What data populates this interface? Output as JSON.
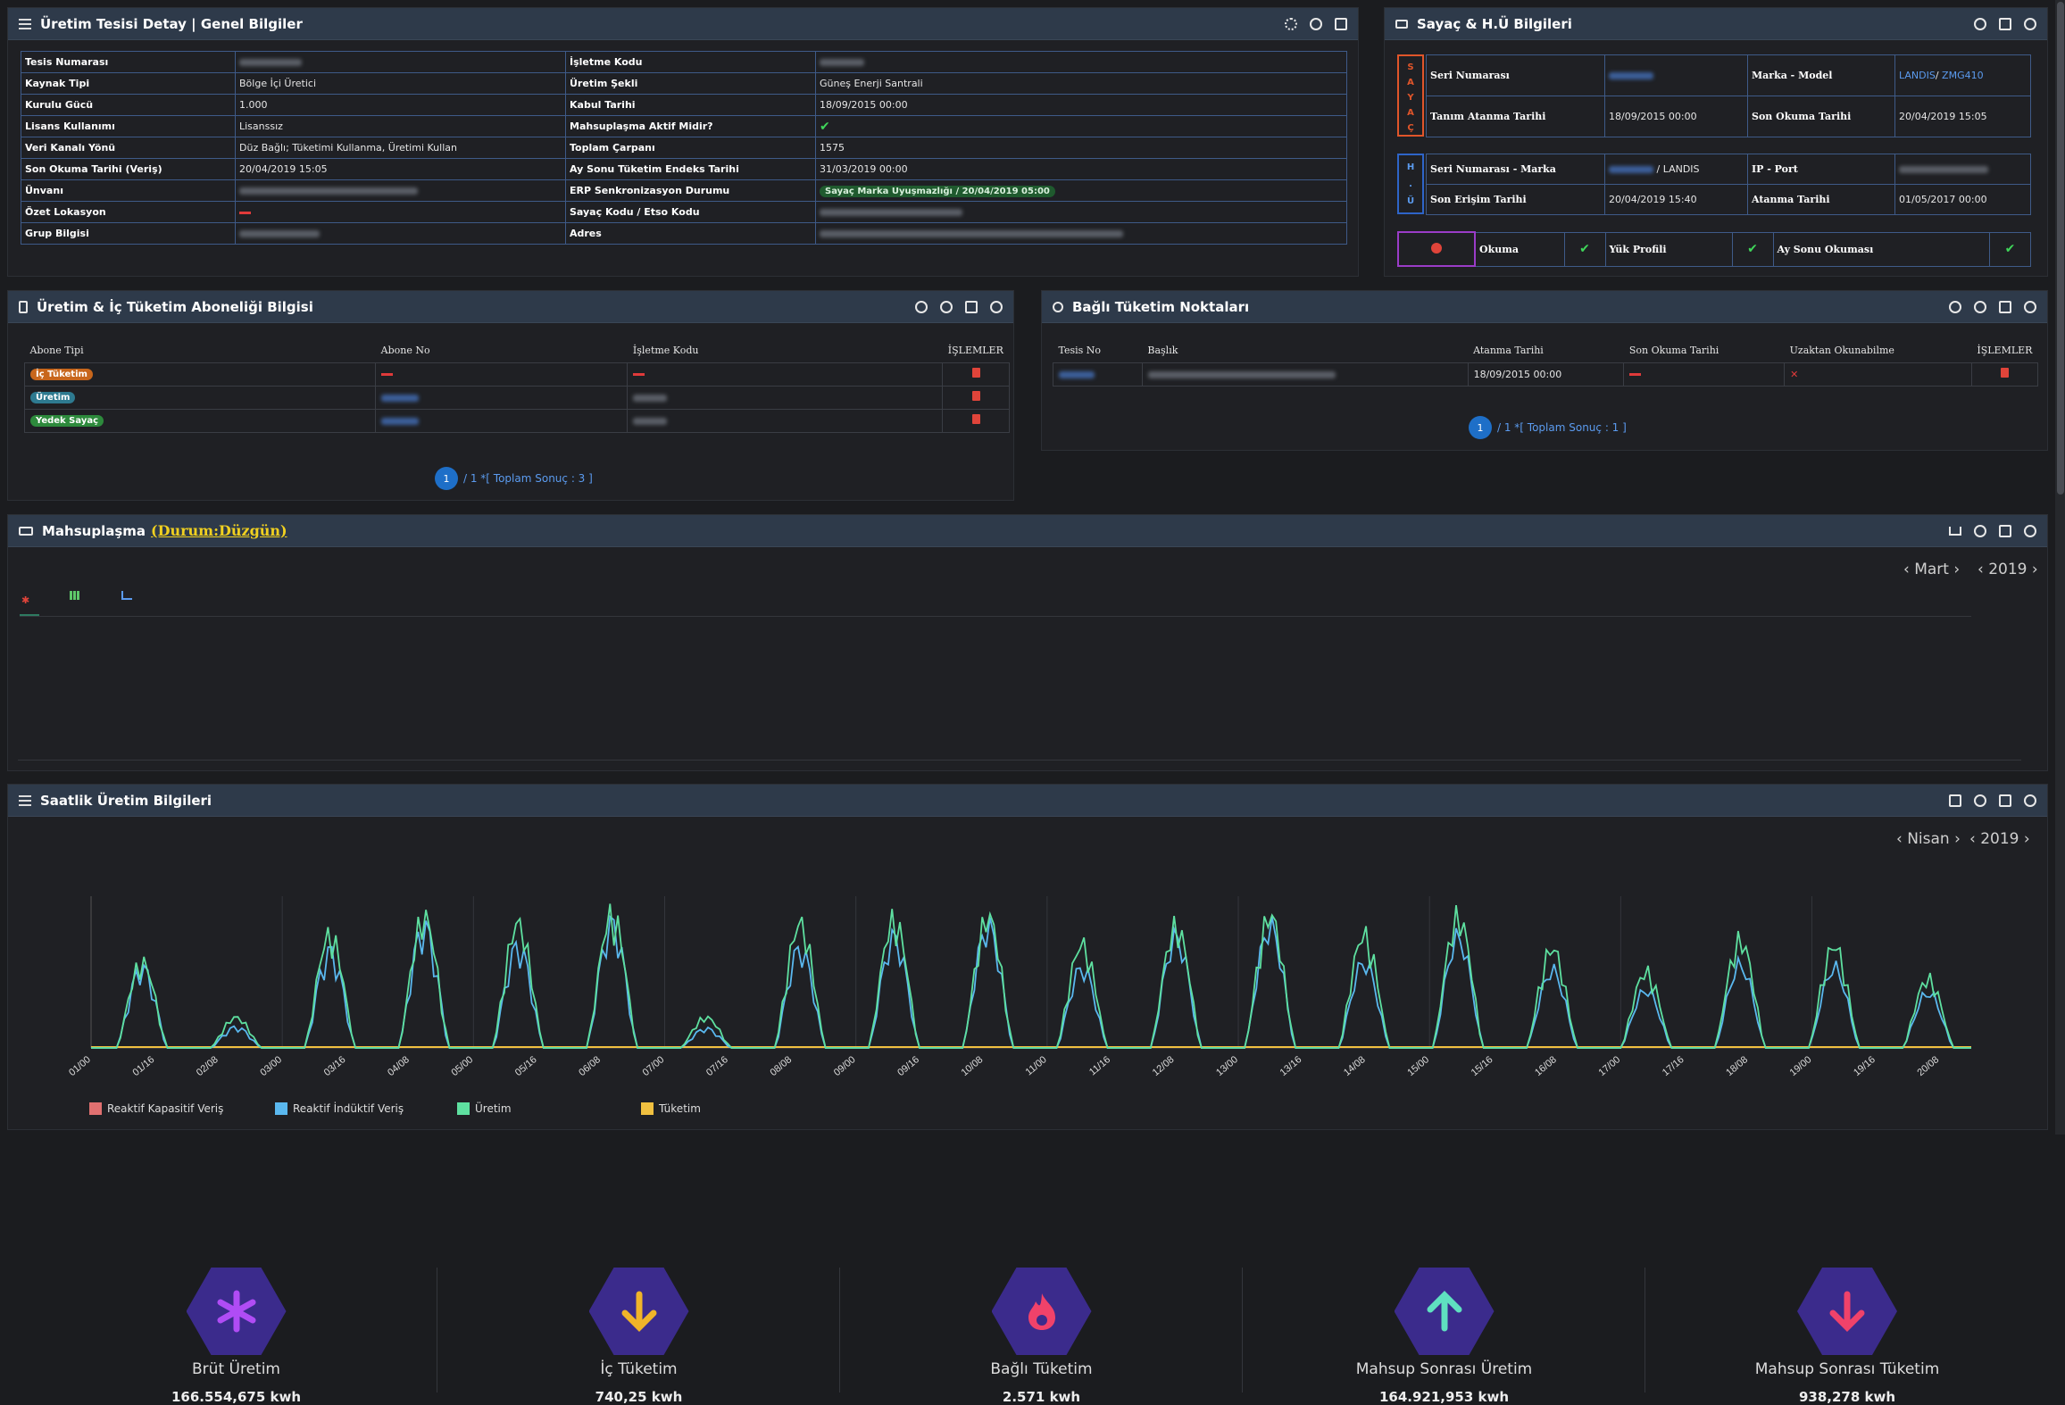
{
  "general": {
    "title": "Üretim Tesisi Detay | Genel Bilgiler",
    "rows": [
      {
        "k1": "Tesis Numarası",
        "v1": "",
        "k2": "İşletme Kodu",
        "v2": ""
      },
      {
        "k1": "Kaynak Tipi",
        "v1": "Bölge İçi Üretici",
        "k2": "Üretim Şekli",
        "v2": "Güneş Enerji Santrali"
      },
      {
        "k1": "Kurulu Gücü",
        "v1": "1.000",
        "k2": "Kabul Tarihi",
        "v2": "18/09/2015 00:00"
      },
      {
        "k1": "Lisans Kullanımı",
        "v1": "Lisanssız",
        "k2": "Mahsuplaşma Aktif Midir?",
        "v2": "✔"
      },
      {
        "k1": "Veri Kanalı Yönü",
        "v1": "Düz Bağlı; Tüketimi Kullanma, Üretimi Kullan",
        "k2": "Toplam Çarpanı",
        "v2": "1575"
      },
      {
        "k1": "Son Okuma Tarihi (Veriş)",
        "v1": "20/04/2019 15:05",
        "k2": "Ay Sonu Tüketim Endeks Tarihi",
        "v2": "31/03/2019 00:00"
      },
      {
        "k1": "Ünvanı",
        "v1": "",
        "k2": "ERP Senkronizasyon Durumu",
        "v2": "Sayaç Marka Uyuşmazlığı / 20/04/2019 05:00"
      },
      {
        "k1": "Özet Lokasyon",
        "v1": "",
        "k2": "Sayaç Kodu / Etso Kodu",
        "v2": ""
      },
      {
        "k1": "Grup Bilgisi",
        "v1": "",
        "k2": "Adres",
        "v2": ""
      }
    ]
  },
  "meter": {
    "title": "Sayaç & H.Ü Bilgileri",
    "sayac_letters": [
      "S",
      "A",
      "Y",
      "A",
      "Ç"
    ],
    "hu_letters": [
      "H",
      ".",
      "Ü"
    ],
    "seri_label": "Seri Numarası",
    "marka_label": "Marka - Model",
    "marka_value": "LANDIS",
    "model_value": "ZMG410",
    "tanim_label": "Tanım Atanma Tarihi",
    "tanim_value": "18/09/2015 00:00",
    "son_okuma_label": "Son Okuma Tarihi",
    "son_okuma_value": "20/04/2019 15:05",
    "hu_seri_label": "Seri Numarası - Marka",
    "hu_marka": "LANDIS",
    "ip_label": "IP - Port",
    "erisim_label": "Son Erişim Tarihi",
    "erisim_value": "20/04/2019 15:40",
    "atanma_label": "Atanma Tarihi",
    "atanma_value": "01/05/2017 00:00",
    "okuma_label": "Okuma",
    "yuk_label": "Yük Profili",
    "ay_sonu_label": "Ay Sonu Okuması"
  },
  "subscription": {
    "title": "Üretim & İç Tüketim Aboneliği Bilgisi",
    "headers": [
      "Abone Tipi",
      "Abone No",
      "İşletme Kodu",
      "İŞLEMLER"
    ],
    "rows": [
      {
        "type": "İç Tüketim",
        "color": "#c8661c"
      },
      {
        "type": "Üretim",
        "color": "#2e7a90"
      },
      {
        "type": "Yedek Sayaç",
        "color": "#2d8a3c"
      }
    ],
    "page": "1",
    "total": "/ 1 *[ Toplam Sonuç : 3 ]"
  },
  "connected": {
    "title": "Bağlı Tüketim Noktaları",
    "headers": [
      "Tesis No",
      "Başlık",
      "Atanma Tarihi",
      "Son Okuma Tarihi",
      "Uzaktan Okunabilme",
      "İŞLEMLER"
    ],
    "row": {
      "atanma": "18/09/2015 00:00"
    },
    "page": "1",
    "total": "/ 1 *[ Toplam Sonuç : 1 ]"
  },
  "netting": {
    "title": "Mahsuplaşma",
    "status": "(Durum:Düzgün)",
    "month": "Mart",
    "year": "2019",
    "stats": [
      {
        "label": "Brüt Üretim",
        "value": "166.554,675",
        "unit": "kwh",
        "icon": "asterisk-icon",
        "color": "#b04cf5"
      },
      {
        "label": "İç Tüketim",
        "value": "740,25",
        "unit": "kwh",
        "icon": "arrow-down-icon",
        "color": "#f0b429"
      },
      {
        "label": "Bağlı Tüketim",
        "value": "2.571",
        "unit": "kwh",
        "icon": "fire-icon",
        "color": "#f0426a"
      },
      {
        "label": "Mahsup Sonrası Üretim",
        "value": "164.921,953",
        "unit": "kwh",
        "icon": "arrow-up-icon",
        "color": "#5fe0c0"
      },
      {
        "label": "Mahsup Sonrası Tüketim",
        "value": "938,278",
        "unit": "kwh",
        "icon": "arrow-down-icon",
        "color": "#f0426a"
      }
    ]
  },
  "hourly": {
    "title": "Saatlik Üretim Bilgileri",
    "month": "Nisan",
    "year": "2019"
  },
  "chart_data": {
    "type": "line",
    "x_ticks": [
      "01/00",
      "01/16",
      "02/08",
      "03/00",
      "03/16",
      "04/08",
      "05/00",
      "05/16",
      "06/08",
      "07/00",
      "07/16",
      "08/08",
      "09/00",
      "09/16",
      "10/08",
      "11/00",
      "11/16",
      "12/08",
      "13/00",
      "13/16",
      "14/08",
      "15/00",
      "15/16",
      "16/08",
      "17/00",
      "17/16",
      "18/08",
      "19/00",
      "19/16",
      "20/08"
    ],
    "series": [
      {
        "name": "Reaktif Kapasitif Veriş",
        "color": "#e07070"
      },
      {
        "name": "Reaktif İndüktif Veriş",
        "color": "#5ab8ef"
      },
      {
        "name": "Üretim",
        "color": "#5ee0a0"
      },
      {
        "name": "Tüketim",
        "color": "#f0c040"
      }
    ],
    "days": [
      {
        "u": 0.62,
        "r": 0.58
      },
      {
        "u": 0.22,
        "r": 0.15
      },
      {
        "u": 0.82,
        "r": 0.7
      },
      {
        "u": 0.95,
        "r": 0.88
      },
      {
        "u": 0.9,
        "r": 0.74
      },
      {
        "u": 0.97,
        "r": 0.9
      },
      {
        "u": 0.22,
        "r": 0.14
      },
      {
        "u": 0.9,
        "r": 0.72
      },
      {
        "u": 0.93,
        "r": 0.8
      },
      {
        "u": 0.95,
        "r": 0.88
      },
      {
        "u": 0.75,
        "r": 0.58
      },
      {
        "u": 0.88,
        "r": 0.8
      },
      {
        "u": 0.96,
        "r": 0.88
      },
      {
        "u": 0.82,
        "r": 0.62
      },
      {
        "u": 0.95,
        "r": 0.8
      },
      {
        "u": 0.72,
        "r": 0.56
      },
      {
        "u": 0.55,
        "r": 0.42
      },
      {
        "u": 0.78,
        "r": 0.6
      },
      {
        "u": 0.74,
        "r": 0.58
      },
      {
        "u": 0.5,
        "r": 0.4
      }
    ]
  }
}
